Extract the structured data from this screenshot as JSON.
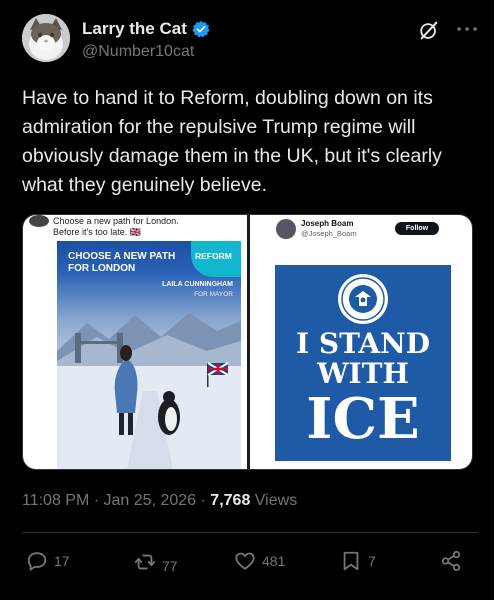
{
  "author": {
    "display_name": "Larry the Cat",
    "handle": "@Number10cat",
    "verified_color": "#1d9bf0"
  },
  "tweet": {
    "text": "Have to hand it to Reform, doubling down on its admiration for the repulsive Trump regime will obviously damage them in the UK, but it's clearly what they genuinely believe."
  },
  "media": {
    "left": {
      "caption_line1": "Choose a new path for London.",
      "caption_line2": "Before it's too late. 🇬🇧",
      "poster_title": "CHOOSE A NEW PATH FOR LONDON",
      "badge": "REFORM",
      "candidate_name": "LAILA CUNNINGHAM",
      "candidate_role": "FOR MAYOR"
    },
    "right": {
      "name": "Joseph Boam",
      "handle": "@Joseph_Boam",
      "follow_label": "Follow",
      "line1": "I STAND",
      "line2": "WITH",
      "line3": "ICE",
      "panel_color": "#1f5aa6"
    }
  },
  "meta": {
    "time": "11:08 PM",
    "sep1": "·",
    "date": "Jan 25, 2026",
    "sep2": "·",
    "views_count": "7,768",
    "views_label": "Views"
  },
  "actions": {
    "reply_count": "17",
    "repost_count": "77",
    "like_count": "481",
    "bookmark_count": "7"
  },
  "icons": {
    "reply": "reply-icon",
    "repost": "repost-icon",
    "like": "like-icon",
    "bookmark": "bookmark-icon",
    "share": "share-icon",
    "grok": "grok-icon",
    "more": "more-icon",
    "verified": "verified-badge-icon"
  }
}
